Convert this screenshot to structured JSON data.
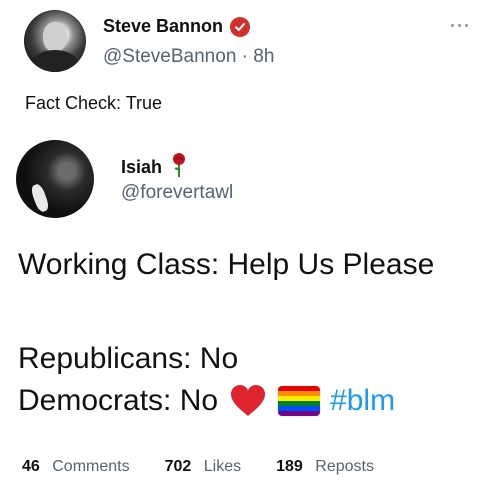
{
  "outer_post": {
    "author_name": "Steve Bannon",
    "handle_time": "@SteveBannon · 8h",
    "text": "Fact Check: True",
    "verified_color": "#d0312d"
  },
  "quoted_post": {
    "author_name": "Isiah",
    "handle": "@forevertawl",
    "rose_icon": "rose-icon",
    "lines": {
      "line1": "Working Class: Help Us Please",
      "line2": "Republicans: No",
      "line3": "Democrats: No",
      "hashtag": "#blm"
    },
    "emoji_icons": [
      "red-heart-icon",
      "rainbow-flag-icon"
    ]
  },
  "stats": {
    "comments": {
      "value": "46",
      "label": "Comments"
    },
    "likes": {
      "value": "702",
      "label": "Likes"
    },
    "reposts": {
      "value": "189",
      "label": "Reposts"
    }
  },
  "colors": {
    "link": "#1d9bf0",
    "secondary_text": "#566370",
    "heart": "#e0242f"
  }
}
